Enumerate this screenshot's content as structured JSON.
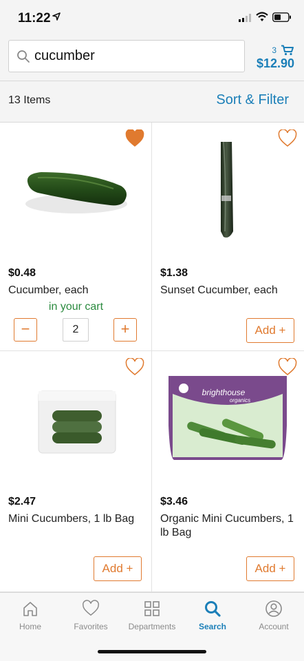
{
  "status": {
    "time": "11:22"
  },
  "search": {
    "query": "cucumber"
  },
  "cart": {
    "count": "3",
    "total": "$12.90"
  },
  "results": {
    "count_label": "13 Items",
    "sort_label": "Sort & Filter"
  },
  "products": [
    {
      "price": "$0.48",
      "name": "Cucumber, each",
      "favorited": true,
      "in_cart_label": "in your cart",
      "quantity": "2",
      "minus": "−",
      "plus": "+"
    },
    {
      "price": "$1.38",
      "name": "Sunset Cucumber, each",
      "favorited": false,
      "add_label": "Add +"
    },
    {
      "price": "$2.47",
      "name": "Mini Cucumbers, 1 lb Bag",
      "favorited": false,
      "add_label": "Add +"
    },
    {
      "price": "$3.46",
      "name": "Organic Mini Cucumbers, 1 lb Bag",
      "favorited": false,
      "add_label": "Add +",
      "image_text": [
        "brighthouse",
        "organics"
      ]
    }
  ],
  "tabs": [
    {
      "label": "Home",
      "icon": "home-icon"
    },
    {
      "label": "Favorites",
      "icon": "heart-icon"
    },
    {
      "label": "Departments",
      "icon": "grid-icon"
    },
    {
      "label": "Search",
      "icon": "search-icon",
      "active": true
    },
    {
      "label": "Account",
      "icon": "account-icon"
    }
  ],
  "colors": {
    "accent_blue": "#1b7fb8",
    "accent_orange": "#e07a2f",
    "cart_green": "#2a8a3e"
  }
}
